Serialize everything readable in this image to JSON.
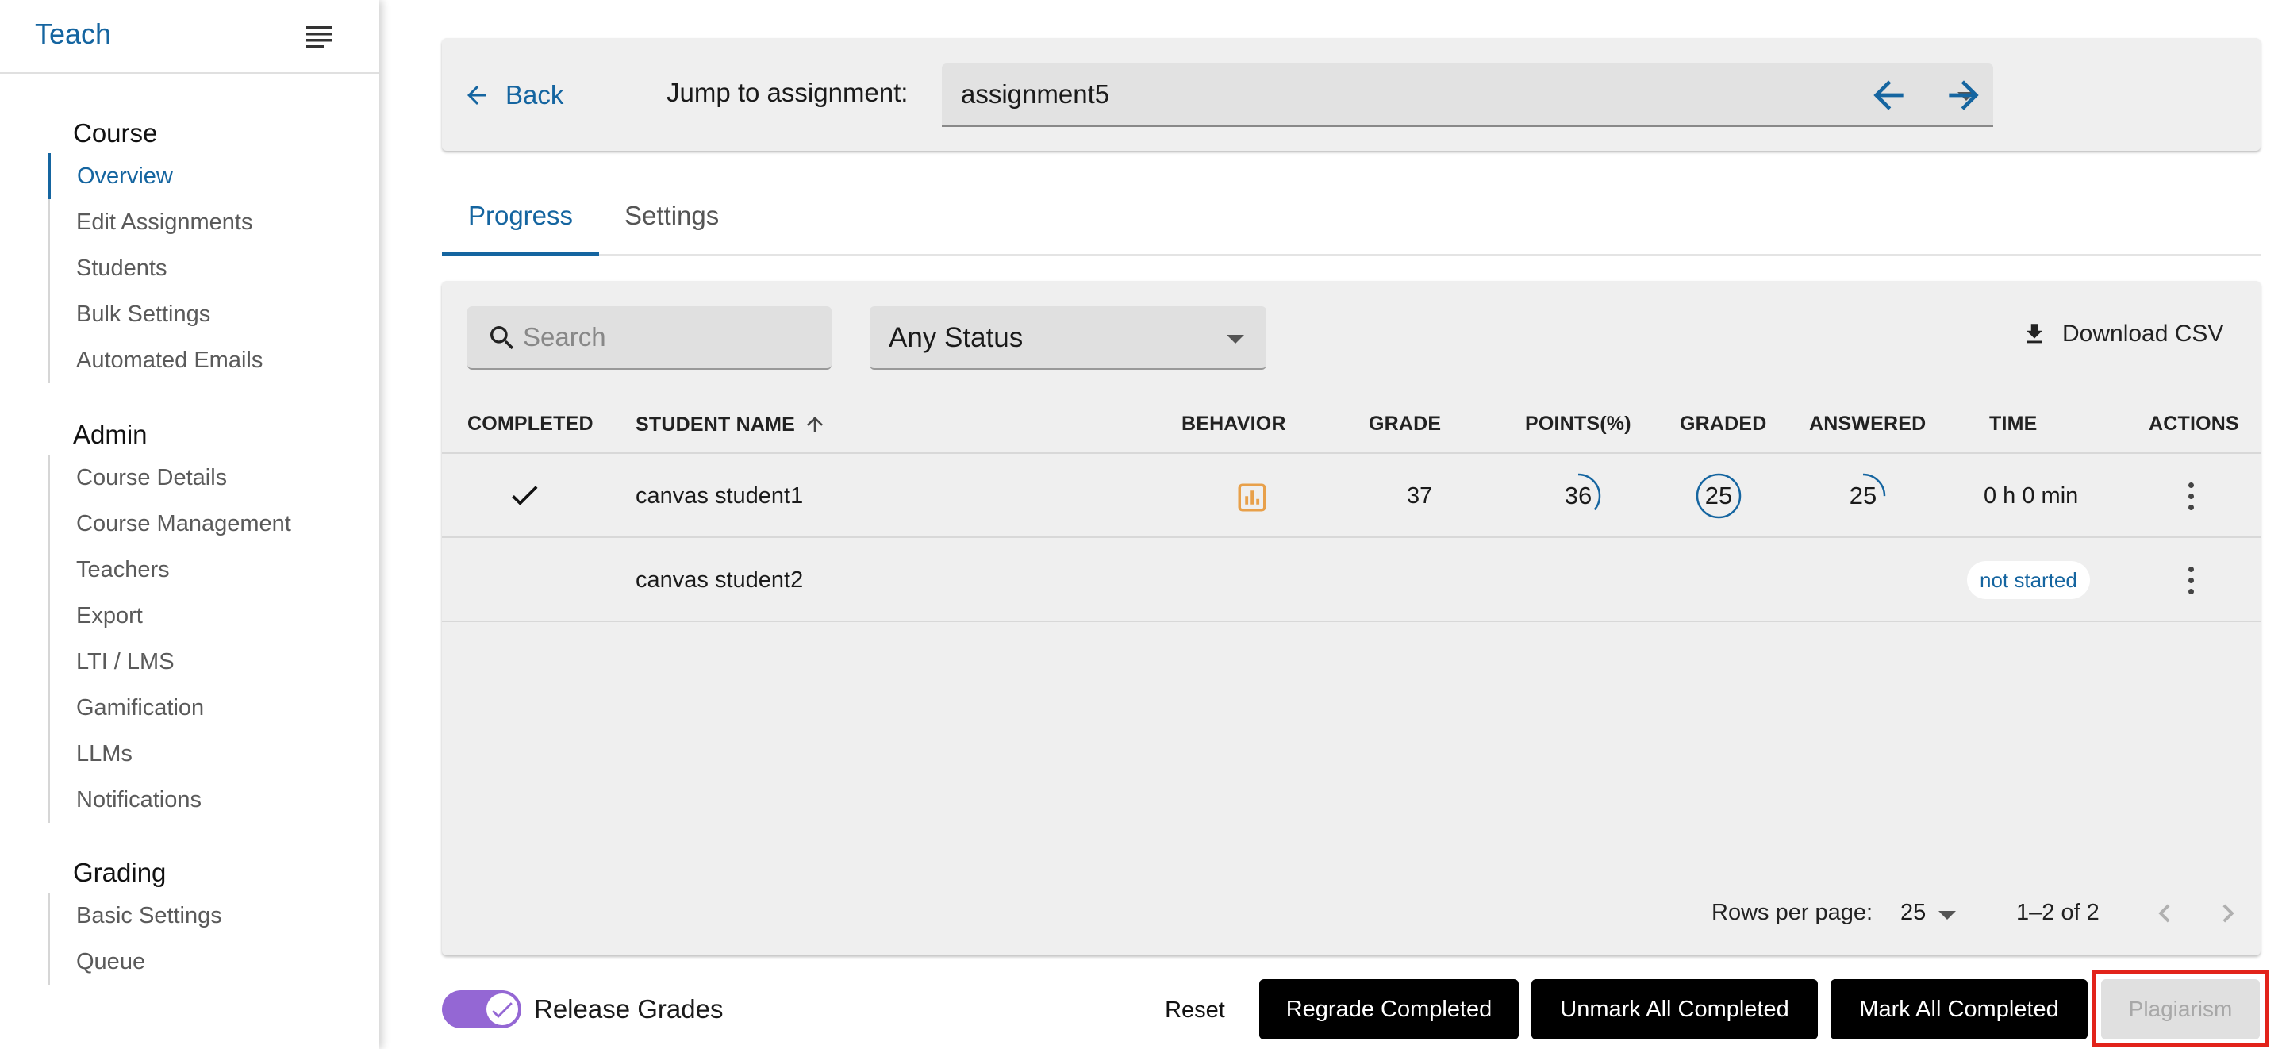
{
  "app": {
    "brand": "Teach"
  },
  "sidebar": {
    "sections": [
      {
        "title": "Course",
        "items": [
          "Overview",
          "Edit Assignments",
          "Students",
          "Bulk Settings",
          "Automated Emails"
        ]
      },
      {
        "title": "Admin",
        "items": [
          "Course Details",
          "Course Management",
          "Teachers",
          "Export",
          "LTI / LMS",
          "Gamification",
          "LLMs",
          "Notifications"
        ]
      },
      {
        "title": "Grading",
        "items": [
          "Basic Settings",
          "Queue"
        ]
      }
    ],
    "active_item": "Overview"
  },
  "topbar": {
    "back_label": "Back",
    "jump_label": "Jump to assignment:",
    "jump_value": "assignment5"
  },
  "tabs": [
    "Progress",
    "Settings"
  ],
  "active_tab": "Progress",
  "filters": {
    "search_placeholder": "Search",
    "status_value": "Any Status",
    "download_label": "Download CSV"
  },
  "table": {
    "headers": {
      "completed": "COMPLETED",
      "student_name": "STUDENT NAME",
      "behavior": "BEHAVIOR",
      "grade": "GRADE",
      "points": "POINTS(%)",
      "graded": "GRADED",
      "answered": "ANSWERED",
      "time": "TIME",
      "actions": "ACTIONS"
    },
    "sort": {
      "column": "student_name",
      "direction": "ascending"
    },
    "rows": [
      {
        "completed": true,
        "name": "canvas student1",
        "grade": "37",
        "points": "36",
        "points_pct": 36,
        "graded": "25",
        "graded_pct": 100,
        "answered": "25",
        "answered_pct": 25,
        "time": "0 h 0 min"
      },
      {
        "completed": false,
        "name": "canvas student2",
        "status": "not started"
      }
    ]
  },
  "pagination": {
    "rows_per_page_label": "Rows per page:",
    "rows_per_page": "25",
    "range": "1–2 of 2"
  },
  "footer": {
    "release_grades_label": "Release Grades",
    "release_grades_on": true,
    "reset_label": "Reset",
    "regrade_label": "Regrade Completed",
    "unmark_label": "Unmark All Completed",
    "mark_label": "Mark All Completed",
    "plagiarism_label": "Plagiarism"
  },
  "colors": {
    "accent": "#1565a0",
    "toggle": "#9467d4",
    "behavior_icon": "#e8a04a",
    "highlight": "#e2231a"
  }
}
